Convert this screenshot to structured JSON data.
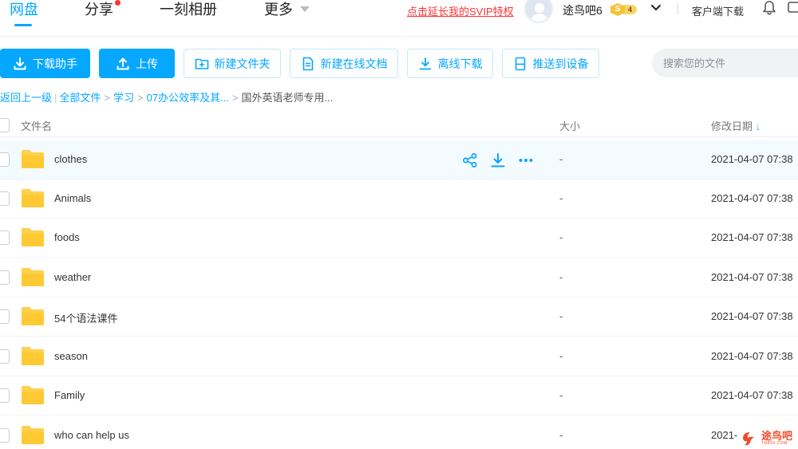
{
  "nav": {
    "tabs": [
      {
        "label": "网盘",
        "active": true
      },
      {
        "label": "分享",
        "has_dot": true
      },
      {
        "label": "一刻相册"
      },
      {
        "label": "更多"
      }
    ],
    "svip_link": "点击延长我的SVIP特权",
    "username": "途鸟吧6",
    "svip_badge": {
      "letter": "S",
      "level": "4"
    },
    "client_download": "客户端下载"
  },
  "toolbar": {
    "download_helper": "下载助手",
    "upload": "上传",
    "new_folder": "新建文件夹",
    "new_online_doc": "新建在线文档",
    "offline_download": "离线下载",
    "push_to_device": "推送到设备",
    "search_placeholder": "搜索您的文件"
  },
  "breadcrumb": {
    "back": "返回上一级",
    "items": [
      "全部文件",
      "学习",
      "07办公效率及其..."
    ],
    "current": "国外英语老师专用..."
  },
  "table": {
    "headers": {
      "name": "文件名",
      "size": "大小",
      "date": "修改日期",
      "sort": "↓"
    },
    "rows": [
      {
        "name": "clothes",
        "size": "-",
        "date": "2021-04-07 07:38"
      },
      {
        "name": "Animals",
        "size": "-",
        "date": "2021-04-07 07:38"
      },
      {
        "name": "foods",
        "size": "-",
        "date": "2021-04-07 07:38"
      },
      {
        "name": "weather",
        "size": "-",
        "date": "2021-04-07 07:38"
      },
      {
        "name": "54个语法课件",
        "size": "-",
        "date": "2021-04-07 07:38"
      },
      {
        "name": "season",
        "size": "-",
        "date": "2021-04-07 07:38"
      },
      {
        "name": "Family",
        "size": "-",
        "date": "2021-04-07 07:38"
      },
      {
        "name": "who can help us",
        "size": "-",
        "date": "2021-"
      }
    ]
  },
  "watermark": {
    "text": "途鸟吧",
    "sub": "TN82V.COM"
  },
  "colors": {
    "accent": "#06a7ff",
    "alert": "#ff3333",
    "folder": "#ffd04b"
  }
}
